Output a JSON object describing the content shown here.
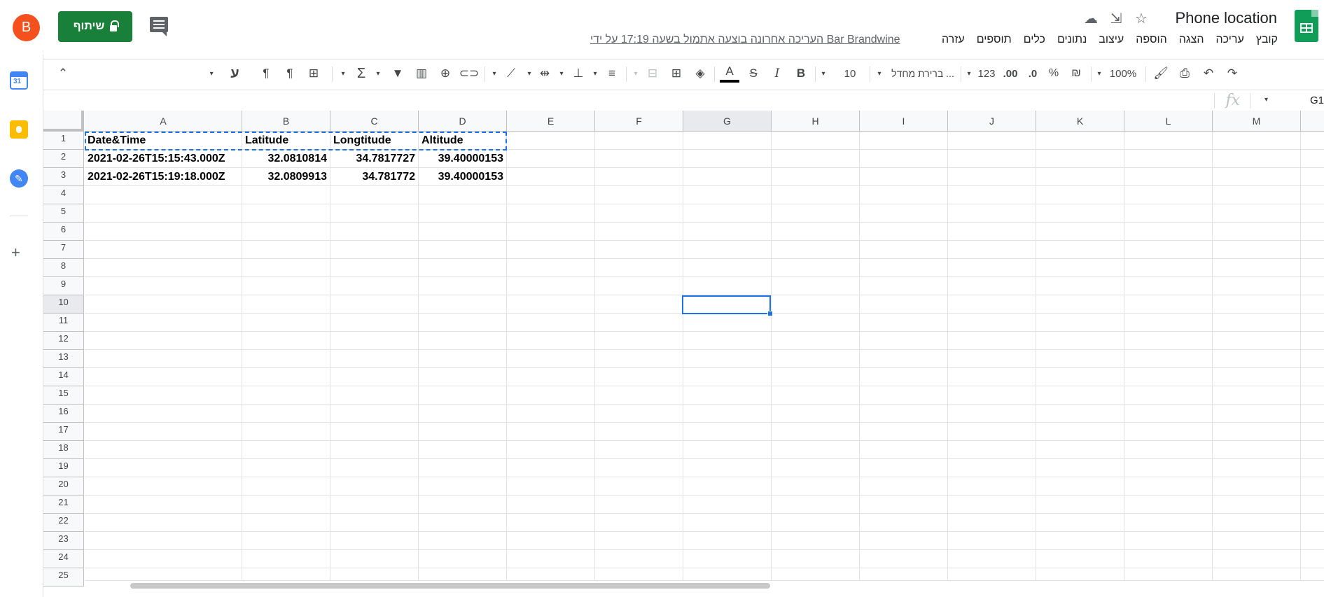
{
  "header": {
    "title": "Phone location",
    "menu": [
      "קובץ",
      "עריכה",
      "הצגה",
      "הוספה",
      "עיצוב",
      "נתונים",
      "כלים",
      "תוספים",
      "עזרה"
    ],
    "last_edit": "העריכה אחרונה בוצעה אתמול בשעה 17:19 על ידי Bar Brandwine",
    "share_label": "שיתוף",
    "avatar_letter": "B",
    "logo_color": "#0f9d58",
    "share_color": "#188038",
    "avatar_color": "#f4511e"
  },
  "toolbar": {
    "zoom": "100%",
    "currency": "₪",
    "percent": "%",
    "decrease_decimal": ".0",
    "increase_decimal": ".00",
    "more_formats": "123",
    "font": "ברירת מחדל ...",
    "font_size": "10",
    "bold": "B",
    "italic": "I",
    "strikethrough": "S",
    "text_color": "A",
    "sigma": "Σ",
    "rtl_text": "ע"
  },
  "formula_bar": {
    "cell_ref": "G1",
    "fx": "fx"
  },
  "grid": {
    "columns": [
      "A",
      "B",
      "C",
      "D",
      "E",
      "F",
      "G",
      "H",
      "I",
      "J",
      "K",
      "L",
      "M"
    ],
    "selected_column": "G",
    "selected_row": "10",
    "rows": [
      "1",
      "2",
      "3",
      "4",
      "5",
      "6",
      "7",
      "8",
      "9",
      "10",
      "11",
      "12",
      "13",
      "14",
      "15",
      "16",
      "17",
      "18",
      "19",
      "20",
      "21",
      "22",
      "23",
      "24",
      "25"
    ],
    "cells": {
      "r1": [
        "Date&Time",
        "Latitude",
        "Longtitude",
        "Altitude"
      ],
      "r2": [
        "2021-02-26T15:15:43.000Z",
        "32.0810814",
        "34.7817727",
        "39.40000153"
      ],
      "r3": [
        "2021-02-26T15:19:18.000Z",
        "32.0809913",
        "34.781772",
        "39.40000153"
      ]
    }
  }
}
